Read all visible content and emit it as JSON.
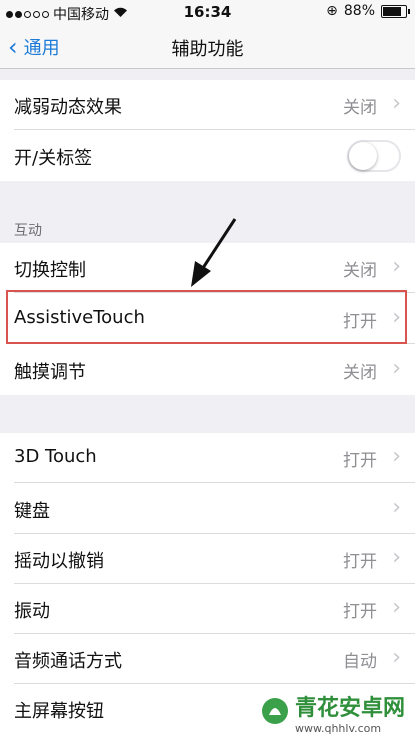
{
  "status": {
    "carrier": "中国移动",
    "time": "16:34",
    "battery": "88%",
    "battery_level": 0.88
  },
  "nav": {
    "back_label": "通用",
    "title": "辅助功能"
  },
  "rows_top": [
    {
      "label": "减弱动态效果",
      "value": "关闭"
    },
    {
      "label": "开/关标签",
      "toggle": false
    }
  ],
  "section_interaction": {
    "header": "互动"
  },
  "rows_interaction": [
    {
      "label": "切换控制",
      "value": "关闭"
    },
    {
      "label": "AssistiveTouch",
      "value": "打开"
    },
    {
      "label": "触摸调节",
      "value": "关闭"
    }
  ],
  "rows_bottom": [
    {
      "label": "3D Touch",
      "value": "打开"
    },
    {
      "label": "键盘",
      "value": ""
    },
    {
      "label": "摇动以撤销",
      "value": "打开"
    },
    {
      "label": "振动",
      "value": "打开"
    },
    {
      "label": "音频通话方式",
      "value": "自动"
    },
    {
      "label": "主屏幕按钮",
      "value": ""
    }
  ],
  "watermark": {
    "text": "青花安卓网",
    "url": "www.qhhlv.com"
  },
  "colors": {
    "accent": "#1d7bd8",
    "highlight": "#d9534f",
    "watermark": "#2f8f3a"
  }
}
